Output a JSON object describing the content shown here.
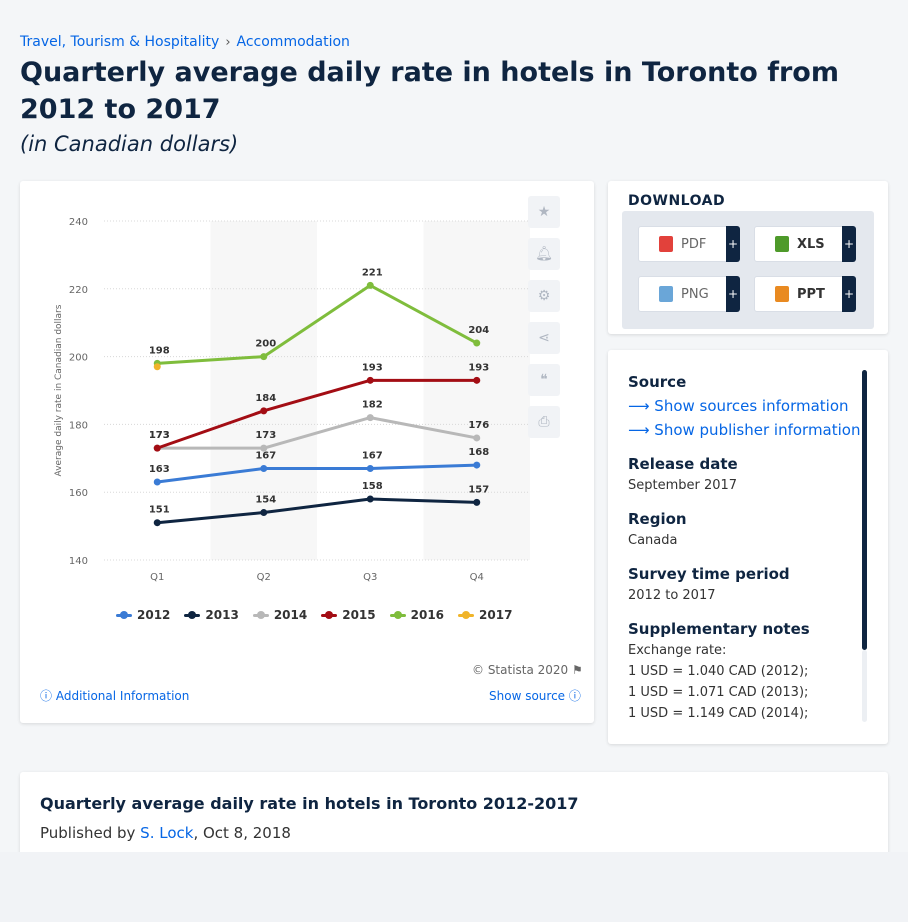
{
  "breadcrumb": {
    "item1": "Travel, Tourism & Hospitality",
    "item2": "Accommodation",
    "sep": "›"
  },
  "title": "Quarterly average daily rate in hotels in Toronto from 2012 to 2017",
  "subtitle": "(in Canadian dollars)",
  "chart_data": {
    "type": "line",
    "categories": [
      "Q1",
      "Q2",
      "Q3",
      "Q4"
    ],
    "ylabel": "Average daily rate in Canadian dollars",
    "ylim": [
      140,
      240
    ],
    "yticks": [
      140,
      160,
      180,
      200,
      220,
      240
    ],
    "series": [
      {
        "name": "2012",
        "color": "#3a7bd5",
        "values": [
          163,
          167,
          167,
          168
        ]
      },
      {
        "name": "2013",
        "color": "#0f2541",
        "values": [
          151,
          154,
          158,
          157
        ]
      },
      {
        "name": "2014",
        "color": "#b8b8b8",
        "values": [
          173,
          173,
          182,
          176
        ]
      },
      {
        "name": "2015",
        "color": "#a30d14",
        "values": [
          173,
          184,
          193,
          193
        ]
      },
      {
        "name": "2016",
        "color": "#7fbd3c",
        "values": [
          198,
          200,
          221,
          204
        ]
      },
      {
        "name": "2017",
        "color": "#f0b429",
        "values": [
          197,
          null,
          null,
          null
        ]
      }
    ]
  },
  "chart_footer": {
    "copyright": "© Statista 2020",
    "additional": "Additional Information",
    "show_source": "Show source"
  },
  "download": {
    "title": "DOWNLOAD",
    "buttons": [
      {
        "label": "PDF",
        "color": "#e2413b"
      },
      {
        "label": "XLS",
        "color": "#4e9a2a"
      },
      {
        "label": "PNG",
        "color": "#6aa6d8"
      },
      {
        "label": "PPT",
        "color": "#e98a21"
      }
    ],
    "plus": "+"
  },
  "info": {
    "source_h": "Source",
    "source_link1": "Show sources information",
    "source_link2": "Show publisher information",
    "release_h": "Release date",
    "release_v": "September 2017",
    "region_h": "Region",
    "region_v": "Canada",
    "period_h": "Survey time period",
    "period_v": "2012 to 2017",
    "notes_h": "Supplementary notes",
    "notes_l1": "Exchange rate:",
    "notes_l2": "1 USD = 1.040 CAD (2012);",
    "notes_l3": "1 USD = 1.071 CAD (2013);",
    "notes_l4": "1 USD = 1.149 CAD (2014);"
  },
  "publication": {
    "title": "Quarterly average daily rate in hotels in Toronto 2012-2017",
    "by": "Published by",
    "author": "S. Lock",
    "date": ", Oct 8, 2018"
  }
}
